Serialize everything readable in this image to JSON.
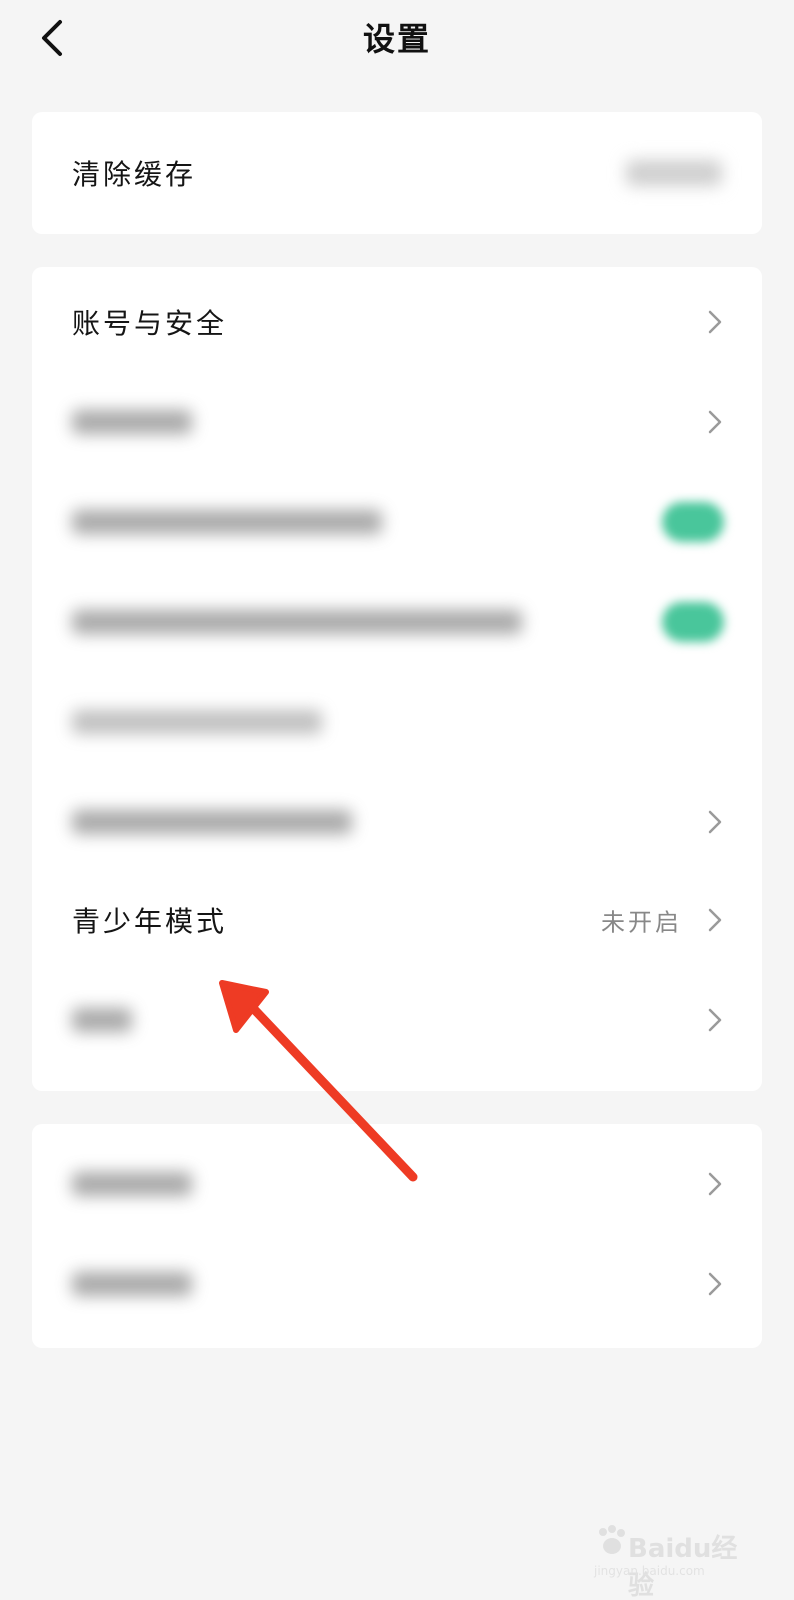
{
  "header": {
    "title": "设置",
    "back_icon": "chevron-left-icon"
  },
  "sections": {
    "cache": {
      "label": "清除缓存"
    },
    "main": {
      "account_security": "账号与安全",
      "youth_mode": "青少年模式",
      "youth_mode_status": "未开启"
    }
  },
  "colors": {
    "background": "#f5f5f5",
    "card": "#ffffff",
    "toggle_on": "#49c69b",
    "annotation_arrow": "#ee3b24",
    "chevron": "#9a9a9a",
    "secondary_text": "#888888"
  },
  "icons": {
    "row_chevron": "chevron-right-icon",
    "toggle": "toggle-switch-icon",
    "annotation": "red-arrow-icon"
  },
  "watermark": {
    "brand": "Baidu经验",
    "url": "jingyan.baidu.com"
  }
}
